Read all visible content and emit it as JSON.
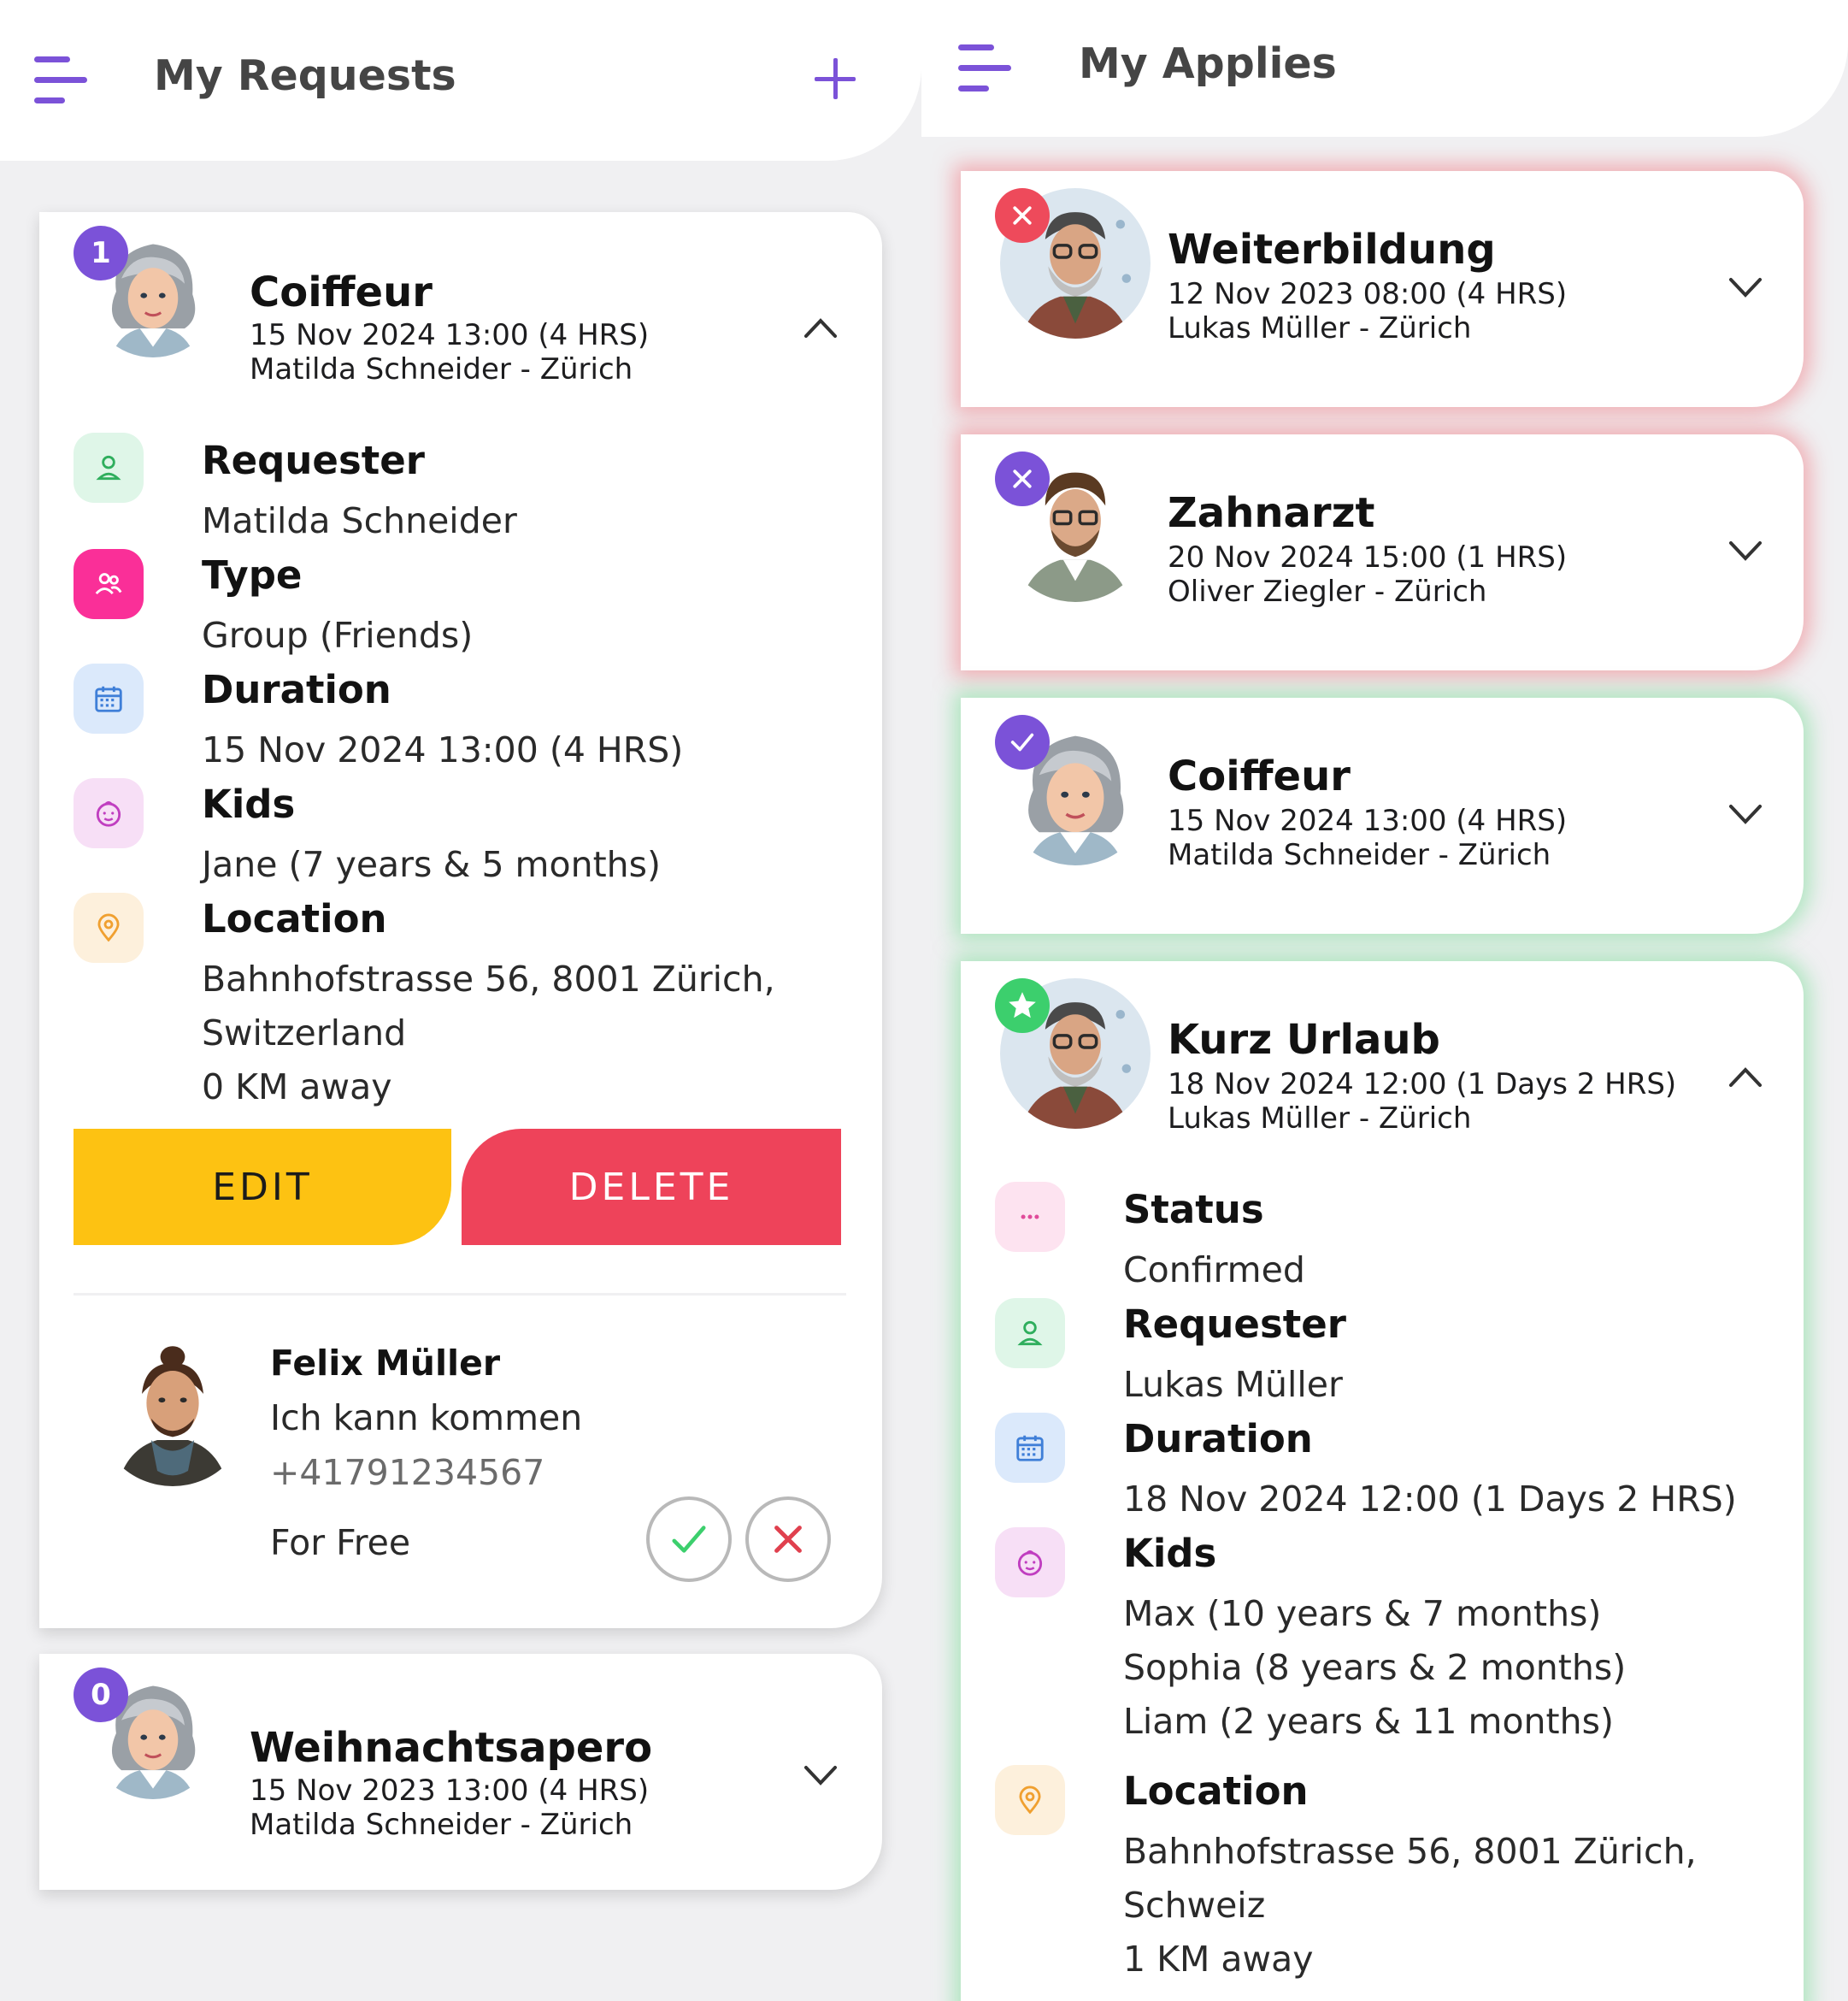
{
  "left": {
    "title": "My Requests",
    "request_card": {
      "badge": "1",
      "title": "Coiffeur",
      "datetime": "15 Nov 2024 13:00 (4 HRS)",
      "owner": "Matilda Schneider - Zürich",
      "details": {
        "requester_label": "Requester",
        "requester_value": "Matilda Schneider",
        "type_label": "Type",
        "type_value": "Group (Friends)",
        "duration_label": "Duration",
        "duration_value": "15 Nov 2024 13:00 (4 HRS)",
        "kids_label": "Kids",
        "kids_value": "Jane (7 years & 5 months)",
        "location_label": "Location",
        "location_line1": "Bahnhofstrasse 56, 8001 Zürich,",
        "location_line2": "Switzerland",
        "distance": "0 KM away"
      },
      "edit_label": "EDIT",
      "delete_label": "DELETE",
      "applicant": {
        "name": "Felix Müller",
        "message": "Ich kann kommen",
        "phone": "+41791234567",
        "price": "For Free"
      }
    },
    "second_card": {
      "badge": "0",
      "title": "Weihnachtsapero",
      "datetime": "15 Nov 2023 13:00 (4 HRS)",
      "owner": "Matilda Schneider - Zürich"
    }
  },
  "right": {
    "title": "My Applies",
    "cards": [
      {
        "title": "Weiterbildung",
        "datetime": "12 Nov 2023 08:00 (4 HRS)",
        "owner": "Lukas Müller - Zürich",
        "status": "rejected"
      },
      {
        "title": "Zahnarzt",
        "datetime": "20 Nov 2024 15:00 (1 HRS)",
        "owner": "Oliver Ziegler - Zürich",
        "status": "cancelled"
      },
      {
        "title": "Coiffeur",
        "datetime": "15 Nov 2024 13:00 (4 HRS)",
        "owner": "Matilda Schneider - Zürich",
        "status": "accepted"
      },
      {
        "title": "Kurz Urlaub",
        "datetime": "18 Nov 2024 12:00 (1 Days 2 HRS)",
        "owner": "Lukas Müller - Zürich",
        "status": "confirmed"
      }
    ],
    "expanded": {
      "status_label": "Status",
      "status_value": "Confirmed",
      "requester_label": "Requester",
      "requester_value": "Lukas Müller",
      "duration_label": "Duration",
      "duration_value": "18 Nov 2024 12:00 (1 Days 2 HRS)",
      "kids_label": "Kids",
      "kids": [
        "Max (10 years & 7 months)",
        "Sophia (8 years & 2 months)",
        "Liam (2 years & 11 months)"
      ],
      "location_label": "Location",
      "location_line1": "Bahnhofstrasse 56, 8001 Zürich,",
      "location_line2": "Schweiz",
      "distance": "1 KM away"
    }
  },
  "colors": {
    "accent": "#7b52d8",
    "edit": "#fdc212",
    "delete": "#ee435a",
    "rejected_glow": "#f07882",
    "accepted_glow": "#78dc96"
  }
}
